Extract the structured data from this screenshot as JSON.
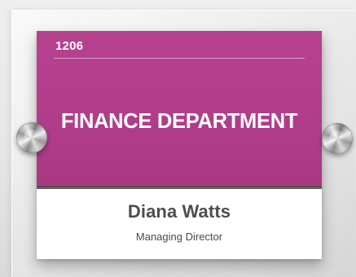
{
  "sign": {
    "room_number": "1206",
    "department": "FINANCE DEPARTMENT",
    "person_name": "Diana Watts",
    "person_title": "Managing Director"
  },
  "colors": {
    "header_background": "#b03d89",
    "band": "#555555",
    "name_text": "#4d4d4d",
    "panel_background": "#ffffff"
  },
  "icons": [
    "standoff-left-icon",
    "standoff-right-icon"
  ]
}
